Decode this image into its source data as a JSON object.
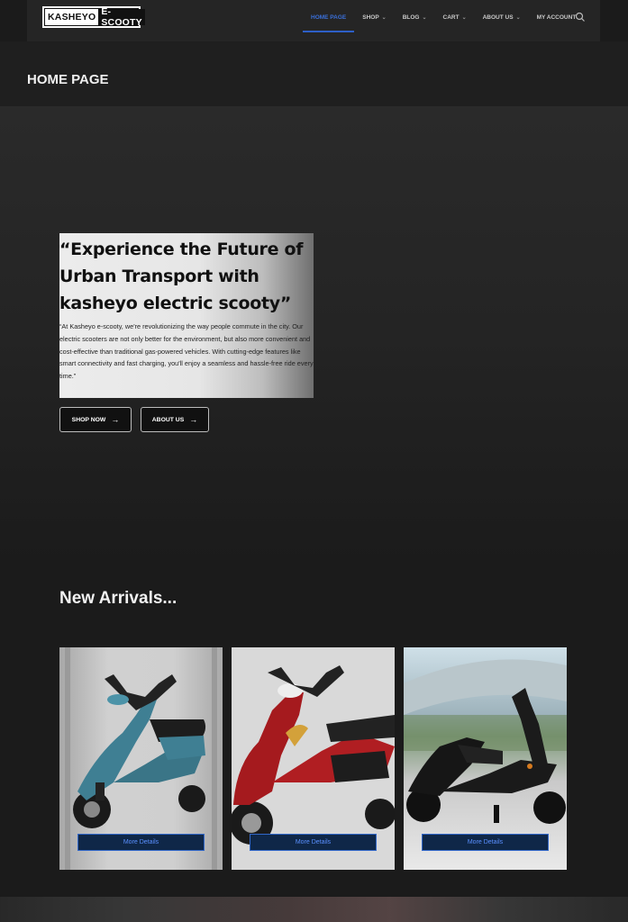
{
  "header": {
    "logo": {
      "part1": "KASHEYO",
      "part2": "E-SCOOTY"
    },
    "nav": [
      {
        "label": "HOME PAGE",
        "active": true,
        "dropdown": false
      },
      {
        "label": "SHOP",
        "active": false,
        "dropdown": true
      },
      {
        "label": "BLOG",
        "active": false,
        "dropdown": true
      },
      {
        "label": "CART",
        "active": false,
        "dropdown": true
      },
      {
        "label": "ABOUT US",
        "active": false,
        "dropdown": true
      },
      {
        "label": "MY ACCOUNT",
        "active": false,
        "dropdown": false
      }
    ],
    "search_icon": "search-icon"
  },
  "page_title": "HOME PAGE",
  "hero": {
    "heading": "“Experience the Future of Urban Transport with kasheyo electric scooty”",
    "text": "“At Kasheyo e-scooty, we're revolutionizing the way people commute in the city. Our electric scooters are not only better for the environment, but also more convenient and cost-effective than traditional gas-powered vehicles. With cutting-edge features like smart connectivity and fast charging, you'll enjoy a seamless and hassle-free ride every time.”",
    "buttons": {
      "shop": "SHOP NOW",
      "about": "ABOUT US"
    }
  },
  "arrivals": {
    "title": "New Arrivals...",
    "products": [
      {
        "color": "#3f7f93",
        "button": "More Details"
      },
      {
        "color": "#a51a1e",
        "button": "More Details"
      },
      {
        "color": "#161616",
        "button": "More Details"
      }
    ]
  },
  "colors": {
    "accent": "#2d5fc7",
    "background": "#1b1b1b",
    "button_bg": "#0f2748"
  }
}
